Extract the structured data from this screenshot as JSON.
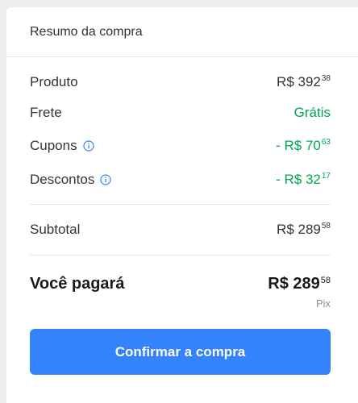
{
  "summary": {
    "title": "Resumo da compra",
    "rows": {
      "produto": {
        "label": "Produto",
        "value_main": "R$ 392",
        "value_cents": "38"
      },
      "frete": {
        "label": "Frete",
        "value": "Grátis"
      },
      "cupons": {
        "label": "Cupons",
        "value_main": "- R$ 70",
        "value_cents": "63",
        "icon": "info-icon"
      },
      "descontos": {
        "label": "Descontos",
        "value_main": "- R$ 32",
        "value_cents": "17",
        "icon": "info-icon"
      },
      "subtotal": {
        "label": "Subtotal",
        "value_main": "R$ 289",
        "value_cents": "58"
      }
    },
    "total": {
      "label": "Você pagará",
      "value_main": "R$ 289",
      "value_cents": "58",
      "method": "Pix"
    },
    "confirm_label": "Confirmar a compra"
  },
  "colors": {
    "accent": "#3483fa",
    "discount_green": "#00a650",
    "info_blue": "#3483fa",
    "text": "#333333",
    "muted": "#8c8c8c"
  }
}
